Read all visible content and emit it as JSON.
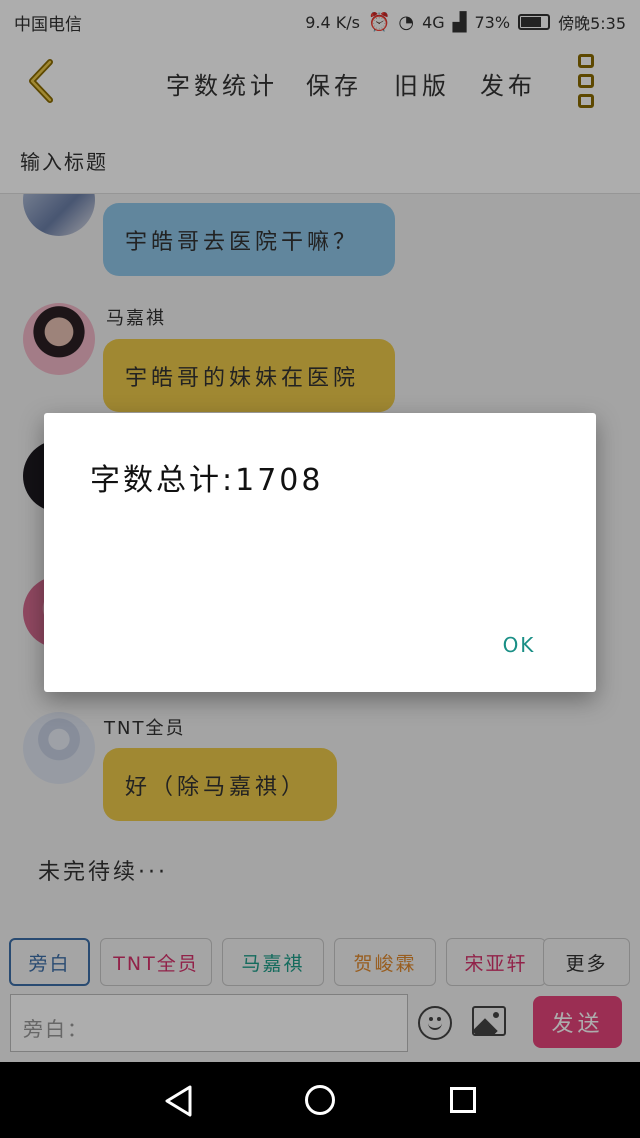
{
  "status_bar": {
    "carrier": "中国电信",
    "speed": "9.4 K/s",
    "network": "4G",
    "battery": "73%",
    "battery_level": 0.73,
    "time": "傍晚5:35"
  },
  "toolbar": {
    "word_count": "字数统计",
    "save": "保存",
    "old_version": "旧版",
    "publish": "发布"
  },
  "title_input": {
    "placeholder": "输入标题"
  },
  "chat": {
    "messages": [
      {
        "name": "",
        "text": "宇皓哥去医院干嘛？",
        "color": "#8fc6e8"
      },
      {
        "name": "马嘉祺",
        "text": "宇皓哥的妹妹在医院",
        "color": "#ecc94b"
      },
      {
        "name": "TNT全员",
        "text": "好（除马嘉祺）",
        "color": "#ecc94b"
      }
    ],
    "to_be_continued": "未完待续···"
  },
  "speakers": [
    {
      "label": "旁白",
      "color": "#3d6fa8"
    },
    {
      "label": "TNT全员",
      "color": "#d6336c"
    },
    {
      "label": "马嘉祺",
      "color": "#1e9e8a"
    },
    {
      "label": "贺峻霖",
      "color": "#e08a2e"
    },
    {
      "label": "宋亚轩",
      "color": "#d6336c"
    },
    {
      "label": "更多",
      "color": "#333333"
    }
  ],
  "composer": {
    "placeholder": "旁白：",
    "send_label": "发送",
    "send_color": "#e5447b"
  },
  "dialog": {
    "message": "字数总计:1708",
    "ok_label": "OK"
  },
  "icons": [
    "back-chevron-icon",
    "more-menu-icon",
    "emoji-icon",
    "image-icon",
    "nav-back-icon",
    "nav-home-icon",
    "nav-recent-icon"
  ]
}
